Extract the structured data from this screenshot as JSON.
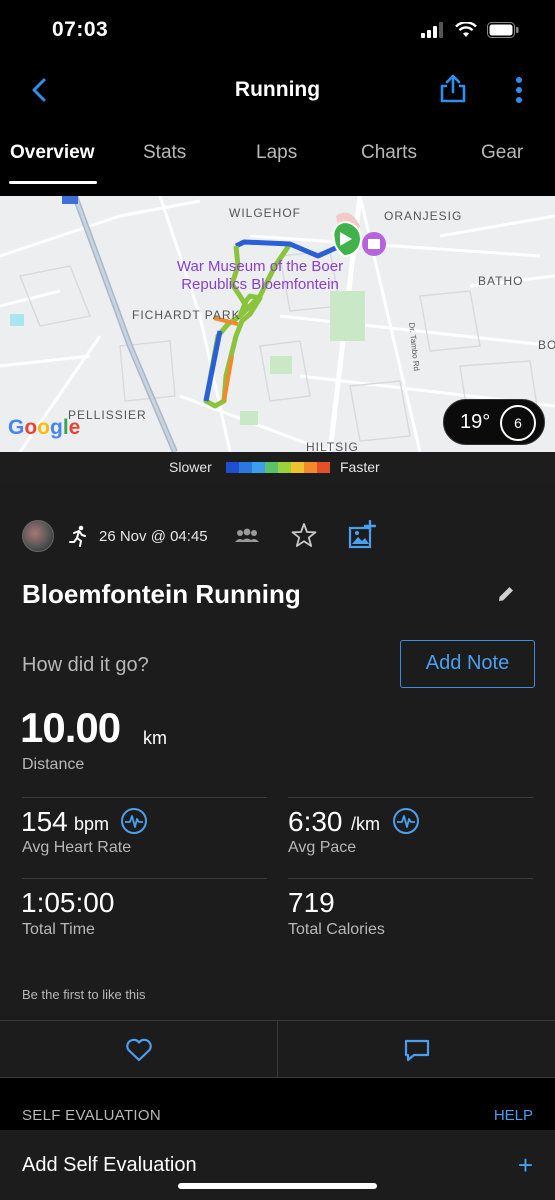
{
  "status_bar": {
    "time": "07:03"
  },
  "nav": {
    "title": "Running"
  },
  "tabs": [
    "Overview",
    "Stats",
    "Laps",
    "Charts",
    "Gear"
  ],
  "map": {
    "labels": [
      "WILGEHOF",
      "ORANJESIG",
      "FICHARDT PARK",
      "BATHO",
      "PELLISSIER",
      "HILTSIG",
      "BO"
    ],
    "street_label": "Dr. Tambo Rd",
    "poi_line1": "War Museum of the Boer",
    "poi_line2": "Republics Bloemfontein",
    "google": [
      "G",
      "o",
      "o",
      "g",
      "l",
      "e"
    ],
    "google_colors": [
      "#4285F4",
      "#EA4335",
      "#FBBC05",
      "#4285F4",
      "#34A853",
      "#EA4335"
    ],
    "route_color_slow": "#1e4fd8",
    "route_color_fast": "#e8502a"
  },
  "weather": {
    "temp": "19°",
    "wind": "6"
  },
  "pace_legend": {
    "slower": "Slower",
    "faster": "Faster",
    "colors": [
      "#1d4fd0",
      "#2a78e0",
      "#3aa0ee",
      "#5cc26a",
      "#9bd23a",
      "#f2c12e",
      "#f28a2a",
      "#e5502a"
    ]
  },
  "activity": {
    "date": "26 Nov @ 04:45",
    "title": "Bloemfontein Running",
    "question": "How did it go?",
    "add_note": "Add Note",
    "distance": {
      "value": "10.00",
      "unit": "km",
      "label": "Distance"
    },
    "heart_rate": {
      "value": "154",
      "unit": "bpm",
      "label": "Avg Heart Rate"
    },
    "pace": {
      "value": "6:30",
      "unit": "/km",
      "label": "Avg Pace"
    },
    "time": {
      "value": "1:05:00",
      "label": "Total Time"
    },
    "calories": {
      "value": "719",
      "label": "Total Calories"
    },
    "likes": "Be the first to like this"
  },
  "self_evaluation": {
    "title": "SELF EVALUATION",
    "help": "HELP",
    "add": "Add Self Evaluation",
    "plus": "+"
  },
  "colors": {
    "accent": "#4a9ff0",
    "card": "#1c1c1c"
  }
}
